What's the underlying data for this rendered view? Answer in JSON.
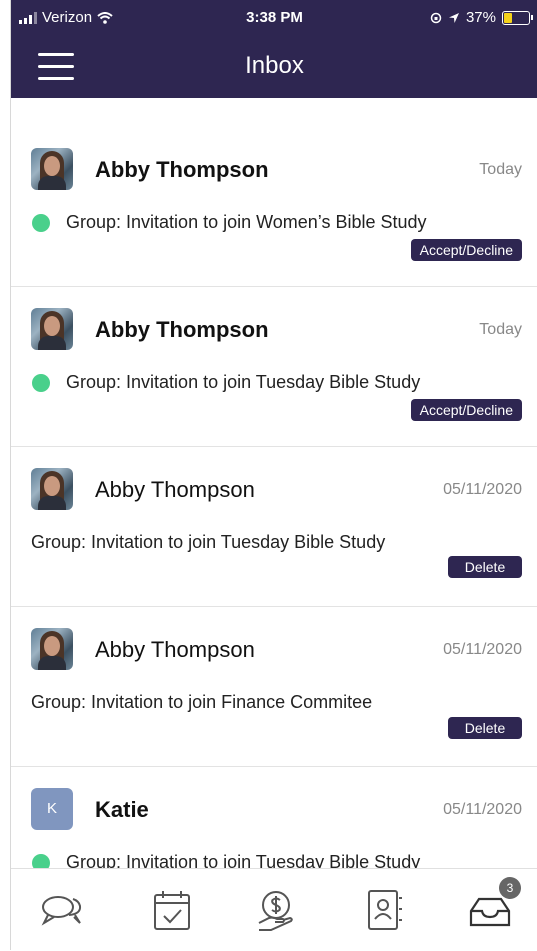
{
  "status_bar": {
    "carrier": "Verizon",
    "time": "3:38 PM",
    "battery": "37%",
    "battery_level": 0.37
  },
  "nav": {
    "title": "Inbox",
    "menu_icon": "hamburger-menu-icon"
  },
  "messages": [
    {
      "sender": "Abby Thompson",
      "date": "Today",
      "text": "Group: Invitation to join Women’s Bible Study",
      "unread": true,
      "action": "Accept/Decline"
    },
    {
      "sender": "Abby Thompson",
      "date": "Today",
      "text": "Group: Invitation to join Tuesday Bible Study",
      "unread": true,
      "action": "Accept/Decline"
    },
    {
      "sender": "Abby Thompson",
      "date": "05/11/2020",
      "text": "Group: Invitation to join Tuesday Bible Study",
      "unread": false,
      "action": "Delete"
    },
    {
      "sender": "Abby Thompson",
      "date": "05/11/2020",
      "text": "Group: Invitation to join Finance Commitee",
      "unread": false,
      "action": "Delete"
    },
    {
      "sender": "Katie",
      "avatar_letter": "K",
      "date": "05/11/2020",
      "text": "Group: Invitation to join Tuesday Bible Study",
      "unread": true
    }
  ],
  "tab_bar": {
    "items": [
      "chat-icon",
      "calendar-check-icon",
      "giving-icon",
      "directory-icon",
      "inbox-icon"
    ],
    "inbox_badge": "3"
  },
  "colors": {
    "primary": "#2e2651",
    "unread_dot": "#49d08b",
    "katie_avatar": "#8096bf"
  }
}
